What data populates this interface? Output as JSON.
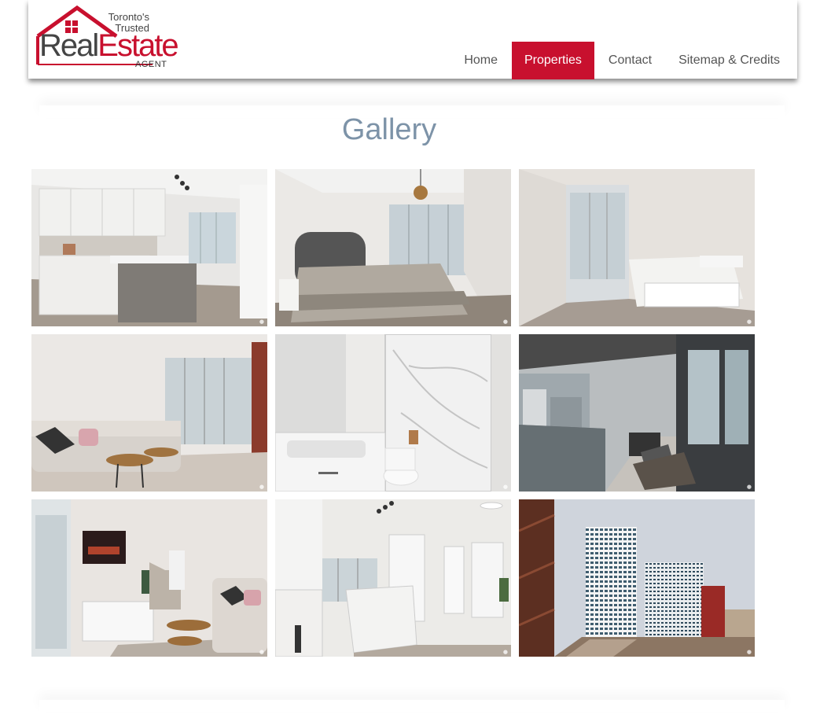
{
  "brand": {
    "line1": "Toronto's",
    "line2": "Trusted",
    "real": "Real",
    "estate": "Estate",
    "agent": "AGENT",
    "accent_color": "#c8102e"
  },
  "nav": {
    "items": [
      {
        "label": "Home"
      },
      {
        "label": "Properties"
      },
      {
        "label": "Contact"
      },
      {
        "label": "Sitemap & Credits"
      }
    ],
    "active": "Properties"
  },
  "gallery": {
    "title": "Gallery",
    "photos": [
      {
        "name": "kitchen-photo"
      },
      {
        "name": "bedroom-photo"
      },
      {
        "name": "second-bedroom-photo"
      },
      {
        "name": "living-room-photo"
      },
      {
        "name": "bathroom-photo"
      },
      {
        "name": "balcony-photo"
      },
      {
        "name": "living-room-tv-photo"
      },
      {
        "name": "kitchen-island-photo"
      },
      {
        "name": "building-exterior-photo"
      }
    ]
  }
}
